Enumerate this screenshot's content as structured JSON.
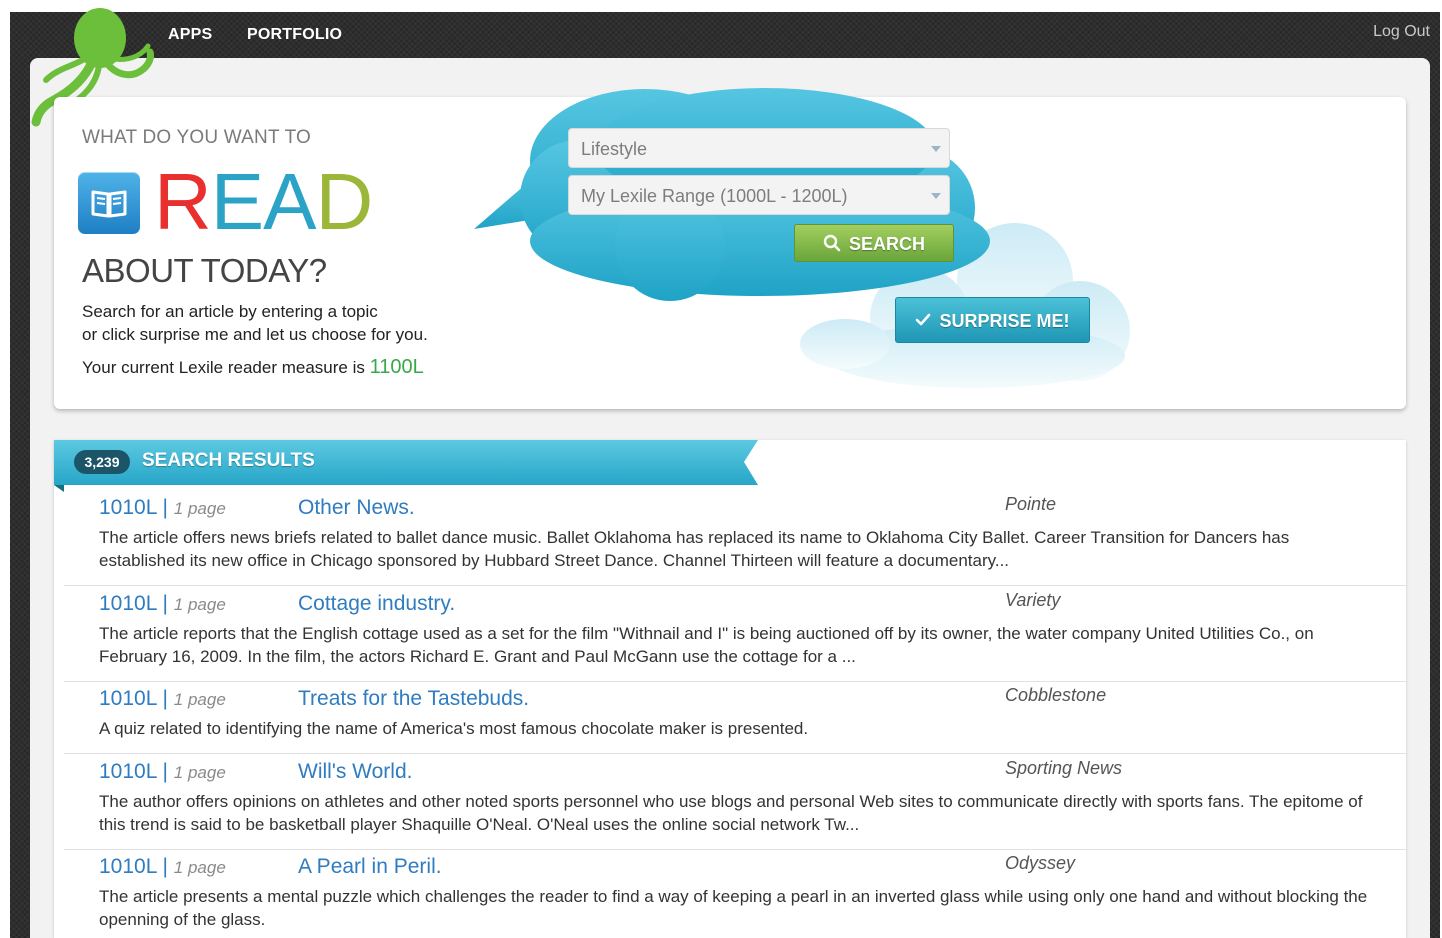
{
  "nav": {
    "apps": "APPS",
    "portfolio": "PORTFOLIO",
    "logout": "Log Out"
  },
  "hero": {
    "heading_top": "WHAT DO YOU WANT TO",
    "read_letters": [
      "R",
      "E",
      "A",
      "D"
    ],
    "read_colors": [
      "#e8302f",
      "#2aa3c7",
      "#2aa3c7",
      "#9bb73a"
    ],
    "heading_bottom": "ABOUT TODAY?",
    "intro_line1": "Search for an article by entering a topic",
    "intro_line2": "or click surprise me and let us choose for you.",
    "lexile_label": "Your current Lexile reader measure is",
    "lexile_value": "1100L"
  },
  "search": {
    "topic_select": "Lifestyle",
    "range_select": "My Lexile Range (1000L - 1200L)",
    "search_button": "SEARCH",
    "surprise_button": "SURPRISE ME!"
  },
  "results": {
    "count": "3,239",
    "title": "SEARCH RESULTS",
    "items": [
      {
        "lexile": "1010L",
        "pages": "1 page",
        "title": "Other News.",
        "source": "Pointe",
        "description": "The article offers news briefs related to ballet dance music. Ballet Oklahoma has replaced its name to Oklahoma City Ballet. Career Transition for Dancers has established its new office in Chicago sponsored by Hubbard Street Dance. Channel Thirteen will feature a documentary..."
      },
      {
        "lexile": "1010L",
        "pages": "1 page",
        "title": "Cottage industry.",
        "source": "Variety",
        "description": "The article reports that the English cottage used as a set for the film \"Withnail and I\" is being auctioned off by its owner, the water company United Utilities Co., on February 16, 2009. In the film, the actors Richard E. Grant and Paul McGann use the cottage for a ..."
      },
      {
        "lexile": "1010L",
        "pages": "1 page",
        "title": "Treats for the Tastebuds.",
        "source": "Cobblestone",
        "description": "A quiz related to identifying the name of America's most famous chocolate maker is presented."
      },
      {
        "lexile": "1010L",
        "pages": "1 page",
        "title": "Will's World.",
        "source": "Sporting News",
        "description": "The author offers opinions on athletes and other noted sports personnel who use blogs and personal Web sites to communicate directly with sports fans. The epitome of this trend is said to be basketball player Shaquille O'Neal. O'Neal uses the online social network Tw..."
      },
      {
        "lexile": "1010L",
        "pages": "1 page",
        "title": "A Pearl in Peril.",
        "source": "Odyssey",
        "description": "The article presents a mental puzzle which challenges the reader to find a way of keeping a pearl in an inverted glass while using only one hand and without blocking the openning of the glass."
      }
    ]
  }
}
